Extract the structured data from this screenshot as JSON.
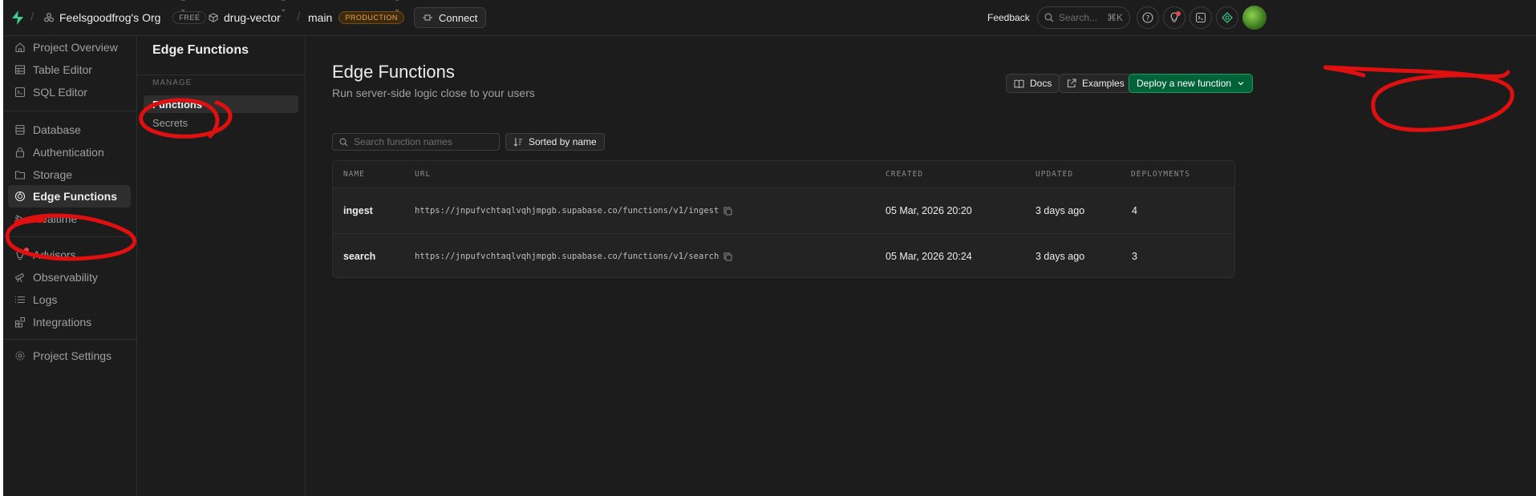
{
  "topbar": {
    "org_name": "Feelsgoodfrog's Org",
    "org_plan": "FREE",
    "project_name": "drug-vector",
    "branch_name": "main",
    "branch_env": "PRODUCTION",
    "connect_label": "Connect",
    "feedback_label": "Feedback",
    "search_placeholder": "Search...",
    "search_shortcut": "⌘K"
  },
  "nav": {
    "items": [
      {
        "label": "Project Overview",
        "icon": "home-icon"
      },
      {
        "label": "Table Editor",
        "icon": "table-icon"
      },
      {
        "label": "SQL Editor",
        "icon": "terminal-icon"
      },
      {
        "label": "Database",
        "icon": "database-icon"
      },
      {
        "label": "Authentication",
        "icon": "lock-icon"
      },
      {
        "label": "Storage",
        "icon": "folder-icon"
      },
      {
        "label": "Edge Functions",
        "icon": "edge-functions-icon",
        "active": true
      },
      {
        "label": "Realtime",
        "icon": "realtime-icon"
      },
      {
        "label": "Advisors",
        "icon": "lightbulb-icon"
      },
      {
        "label": "Observability",
        "icon": "telescope-icon"
      },
      {
        "label": "Logs",
        "icon": "list-icon"
      },
      {
        "label": "Integrations",
        "icon": "integrations-icon"
      },
      {
        "label": "Project Settings",
        "icon": "gear-icon"
      }
    ]
  },
  "subnav": {
    "title": "Edge Functions",
    "group_label": "MANAGE",
    "items": [
      {
        "label": "Functions",
        "active": true
      },
      {
        "label": "Secrets"
      }
    ]
  },
  "main": {
    "title": "Edge Functions",
    "subtitle": "Run server-side logic close to your users",
    "docs_label": "Docs",
    "examples_label": "Examples",
    "deploy_label": "Deploy a new function",
    "search_placeholder": "Search function names",
    "sort_label": "Sorted by name",
    "table": {
      "columns": [
        "NAME",
        "URL",
        "CREATED",
        "UPDATED",
        "DEPLOYMENTS"
      ],
      "rows": [
        {
          "name": "ingest",
          "url": "https://jnpufvchtaqlvqhjmpgb.supabase.co/functions/v1/ingest",
          "created": "05 Mar, 2026 20:20",
          "updated": "3 days ago",
          "deployments": "4"
        },
        {
          "name": "search",
          "url": "https://jnpufvchtaqlvqhjmpgb.supabase.co/functions/v1/search",
          "created": "05 Mar, 2026 20:24",
          "updated": "3 days ago",
          "deployments": "3"
        }
      ]
    }
  },
  "colors": {
    "background": "#1c1c1c",
    "accent_green": "#3ecf8e",
    "deploy_button": "#006239",
    "annotation_red": "#e01010",
    "production_badge": "#f3a33a"
  }
}
